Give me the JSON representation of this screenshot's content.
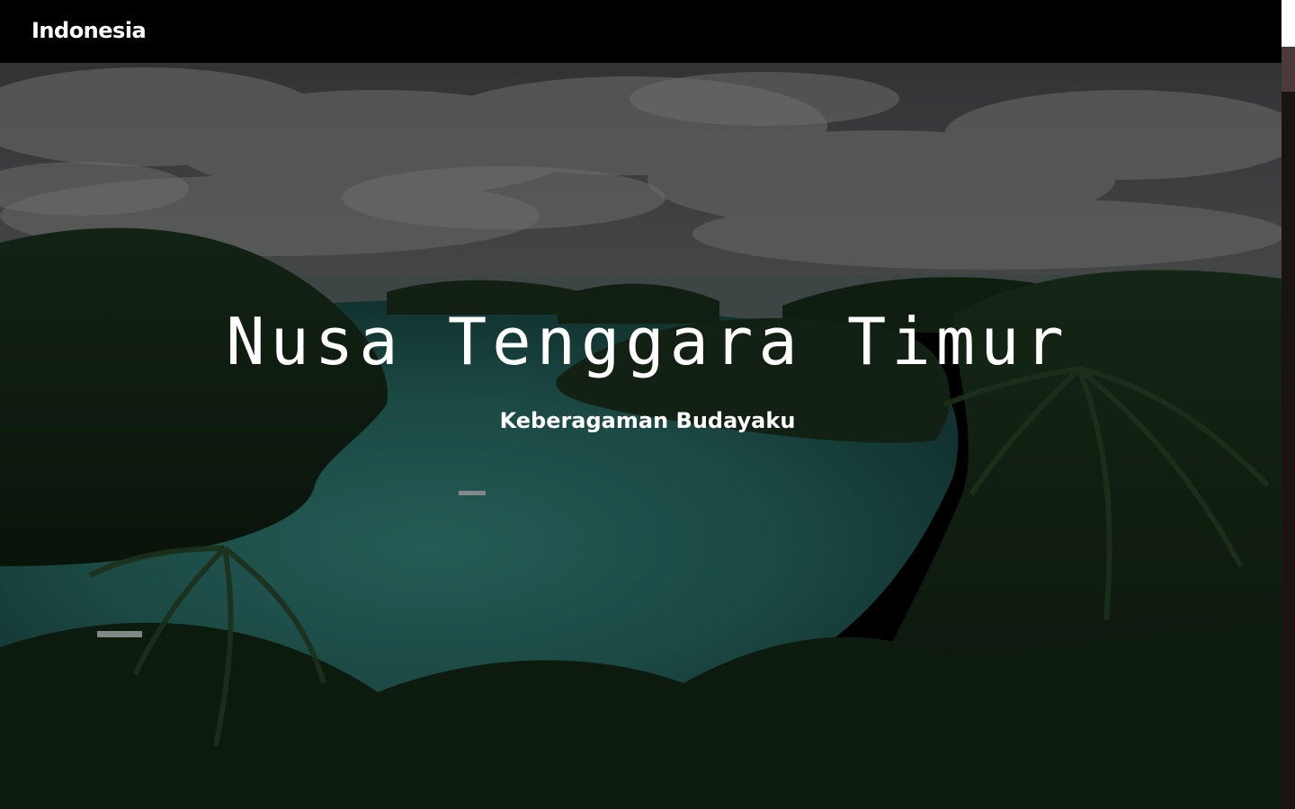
{
  "navbar": {
    "brand": "Indonesia"
  },
  "hero": {
    "title": "Nusa Tenggara Timur",
    "subtitle": "Keberagaman Budayaku",
    "image": "tropical-islands-lagoon-photo"
  },
  "colors": {
    "navbar_bg": "#000000",
    "text": "#ffffff",
    "lagoon": "#2a7a70",
    "forest": "#1d3a1f"
  }
}
